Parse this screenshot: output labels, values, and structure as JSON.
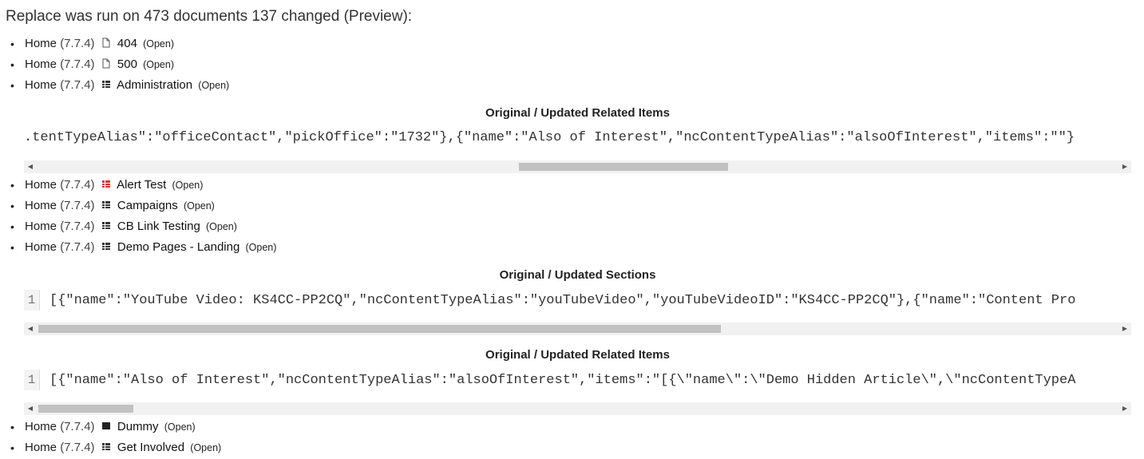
{
  "summary": "Replace was run on 473 documents 137 changed (Preview):",
  "open_label": "(Open)",
  "groups": [
    {
      "items": [
        {
          "root": "Home",
          "version": "(7.7.4)",
          "icon": "page-icon",
          "name": "404"
        },
        {
          "root": "Home",
          "version": "(7.7.4)",
          "icon": "page-icon",
          "name": "500"
        },
        {
          "root": "Home",
          "version": "(7.7.4)",
          "icon": "grid-icon",
          "name": "Administration"
        }
      ],
      "diffs": [
        {
          "title": "Original / Updated Related Items",
          "line_number": "",
          "code": ".tentTypeAlias\":\"officeContact\",\"pickOffice\":\"1732\"},{\"name\":\"Also of Interest\",\"ncContentTypeAlias\":\"alsoOfInterest\",\"items\":\"\"}",
          "scroll_fraction": 0.45
        }
      ]
    },
    {
      "items": [
        {
          "root": "Home",
          "version": "(7.7.4)",
          "icon": "grid-icon-red",
          "name": "Alert Test"
        },
        {
          "root": "Home",
          "version": "(7.7.4)",
          "icon": "grid-icon",
          "name": "Campaigns"
        },
        {
          "root": "Home",
          "version": "(7.7.4)",
          "icon": "grid-icon",
          "name": "CB Link Testing"
        },
        {
          "root": "Home",
          "version": "(7.7.4)",
          "icon": "grid-icon",
          "name": "Demo Pages - Landing"
        }
      ],
      "diffs": [
        {
          "title": "Original / Updated Sections",
          "line_number": "1",
          "code": "[{\"name\":\"YouTube Video: KS4CC-PP2CQ\",\"ncContentTypeAlias\":\"youTubeVideo\",\"youTubeVideoID\":\"KS4CC-PP2CQ\"},{\"name\":\"Content Pro",
          "scroll_fraction": 0.0
        },
        {
          "title": "Original / Updated Related Items",
          "line_number": "1",
          "code": "[{\"name\":\"Also of Interest\",\"ncContentTypeAlias\":\"alsoOfInterest\",\"items\":\"[{\\\"name\\\":\\\"Demo Hidden Article\\\",\\\"ncContentTypeA",
          "scroll_fraction": 0.0
        }
      ]
    },
    {
      "items": [
        {
          "root": "Home",
          "version": "(7.7.4)",
          "icon": "square-icon",
          "name": "Dummy"
        },
        {
          "root": "Home",
          "version": "(7.7.4)",
          "icon": "grid-icon",
          "name": "Get Involved"
        }
      ],
      "diffs": []
    }
  ]
}
